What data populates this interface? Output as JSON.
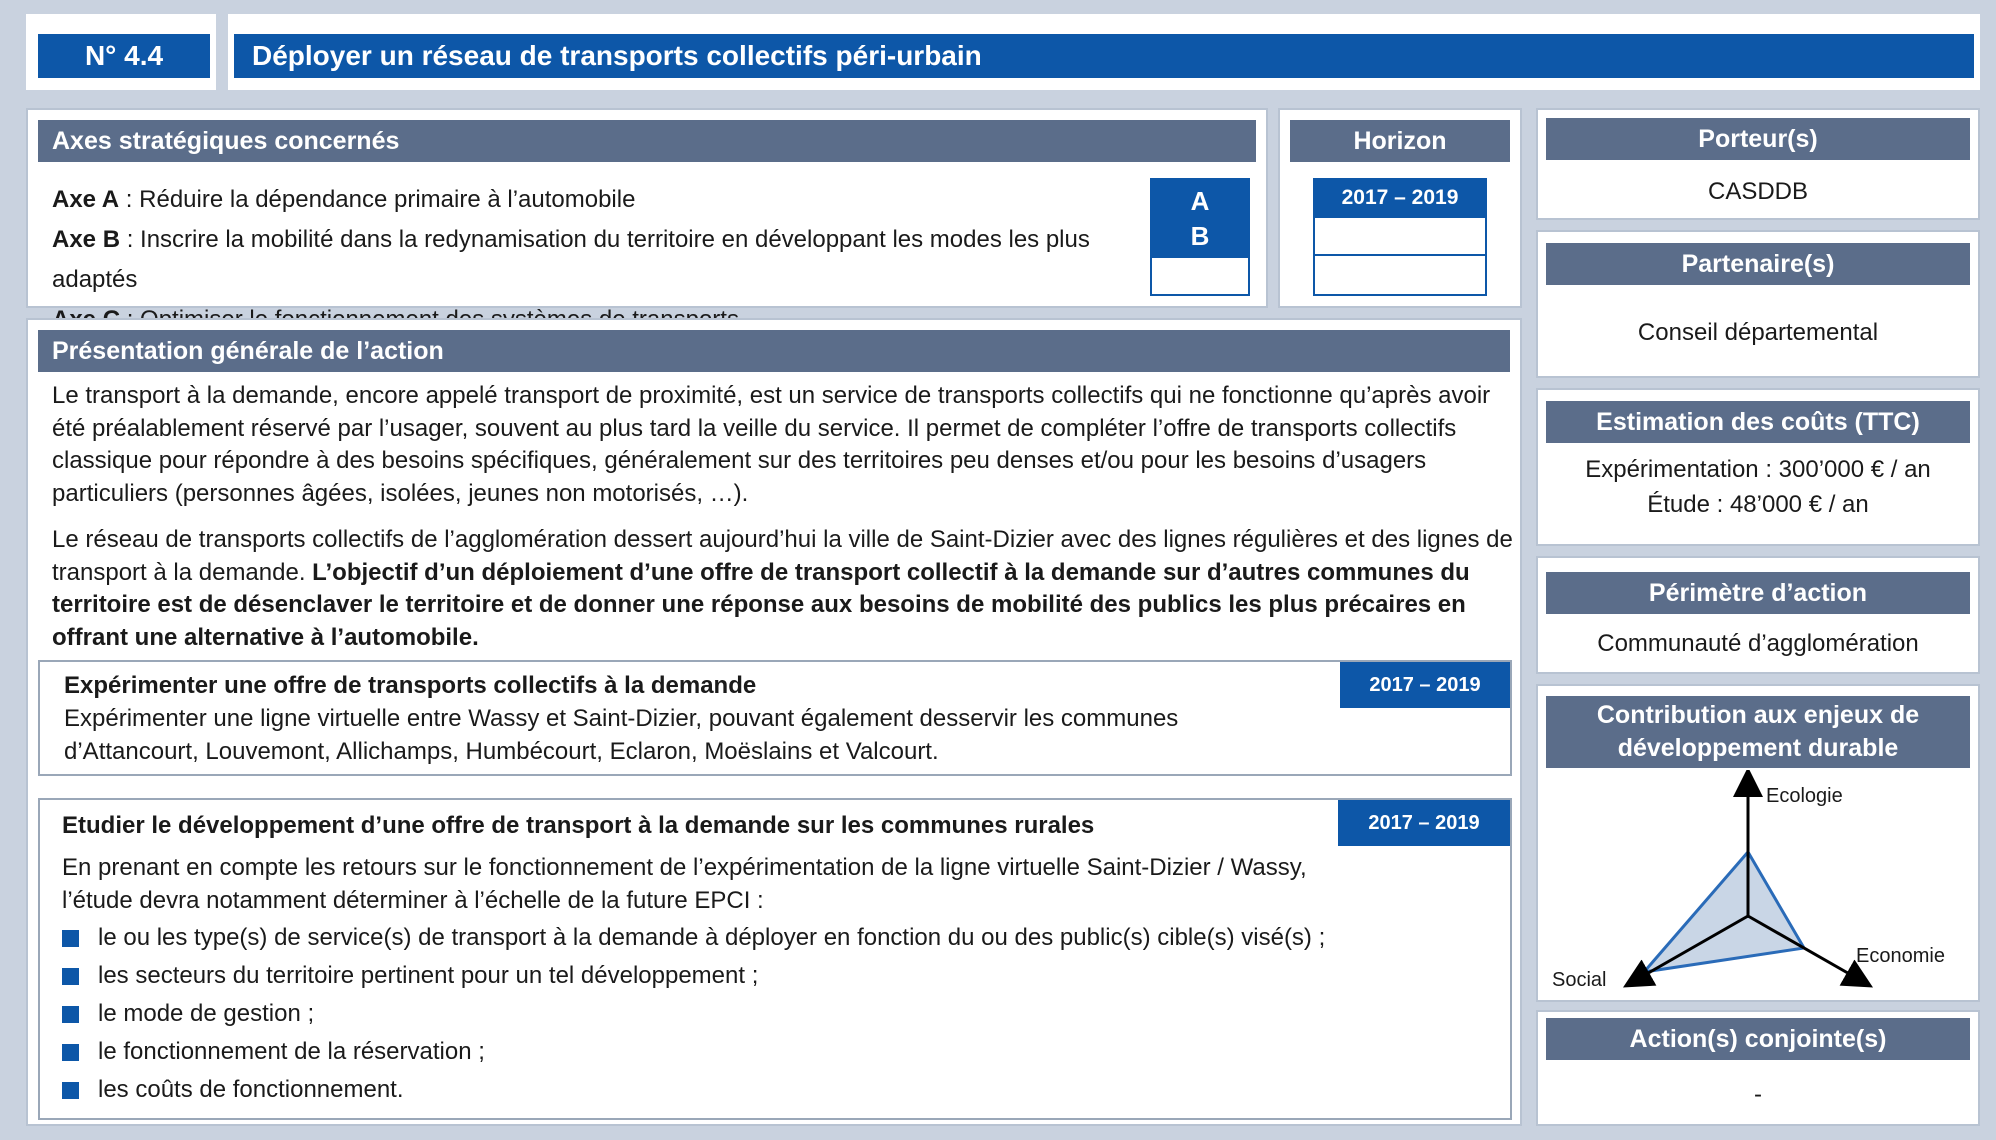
{
  "header": {
    "number": "N° 4.4",
    "title": "Déployer un réseau de transports collectifs péri-urbain"
  },
  "axes": {
    "heading": "Axes stratégiques concernés",
    "items": [
      {
        "label": "Axe A",
        "text": " : Réduire la dépendance primaire à l’automobile"
      },
      {
        "label": "Axe B",
        "text": " : Inscrire la mobilité dans la redynamisation du territoire en développant les modes les plus adaptés"
      },
      {
        "label": "Axe C",
        "text": " : Optimiser le fonctionnement des systèmes de transports"
      }
    ],
    "selected": [
      "A",
      "B",
      ""
    ]
  },
  "horizon": {
    "heading": "Horizon",
    "cells": [
      "2017 – 2019",
      "",
      ""
    ]
  },
  "porteur": {
    "heading": "Porteur(s)",
    "value": "CASDDB"
  },
  "partenaires": {
    "heading": "Partenaire(s)",
    "value": "Conseil départemental"
  },
  "couts": {
    "heading": "Estimation des coûts (TTC)",
    "line1": "Expérimentation : 300’000 € / an",
    "line2": "Étude : 48’000 € / an"
  },
  "perimetre": {
    "heading": "Périmètre d’action",
    "value": "Communauté d’agglomération"
  },
  "contribution": {
    "heading_line1": "Contribution aux enjeux de",
    "heading_line2": "développement durable",
    "axis_ecologie": "Ecologie",
    "axis_economie": "Economie",
    "axis_social": "Social"
  },
  "conjointes": {
    "heading": "Action(s) conjointe(s)",
    "value": "-"
  },
  "presentation": {
    "heading": "Présentation générale de l’action",
    "p1": "Le transport à la demande, encore appelé transport de proximité, est un service de transports collectifs qui ne fonctionne qu’après avoir été préalablement réservé par l’usager, souvent au plus tard la veille du service. Il permet de compléter l’offre de transports collectifs classique pour répondre à des besoins spécifiques, généralement sur des territoires peu denses et/ou pour les besoins d’usagers particuliers (personnes âgées, isolées, jeunes non motorisés, …).",
    "p2_normal": "Le réseau de transports collectifs de l’agglomération dessert aujourd’hui la ville de Saint-Dizier avec des lignes régulières et des lignes de transport à la demande. ",
    "p2_bold": "L’objectif d’un déploiement d’une offre de transport collectif à la demande sur d’autres communes du territoire est de désenclaver le territoire et de donner une réponse aux besoins de mobilité des publics les plus précaires en offrant une alternative à l’automobile."
  },
  "action1": {
    "title": "Expérimenter une offre de transports collectifs à la demande",
    "period": "2017 – 2019",
    "text": "Expérimenter une ligne virtuelle entre Wassy et Saint-Dizier, pouvant également desservir les communes d’Attancourt, Louvemont, Allichamps, Humbécourt, Eclaron,  Moëslains et Valcourt."
  },
  "action2": {
    "title": "Etudier le développement d’une offre de transport à la demande sur les communes rurales",
    "period": "2017 – 2019",
    "intro": "En prenant en compte les retours sur le fonctionnement de l’expérimentation de la ligne virtuelle Saint-Dizier / Wassy, l’étude devra notamment déterminer à l’échelle de la future EPCI :",
    "bullets": [
      "le ou les type(s) de service(s) de transport à la demande à déployer en fonction du ou des public(s) cible(s) visé(s) ;",
      "les secteurs du territoire pertinent pour un tel développement ;",
      "le mode de gestion ;",
      "le fonctionnement de la réservation ;",
      "les coûts de fonctionnement."
    ]
  },
  "colors": {
    "accent": "#0d57a8",
    "header_gray": "#5b6d8a",
    "frame": "#c9d2df"
  }
}
